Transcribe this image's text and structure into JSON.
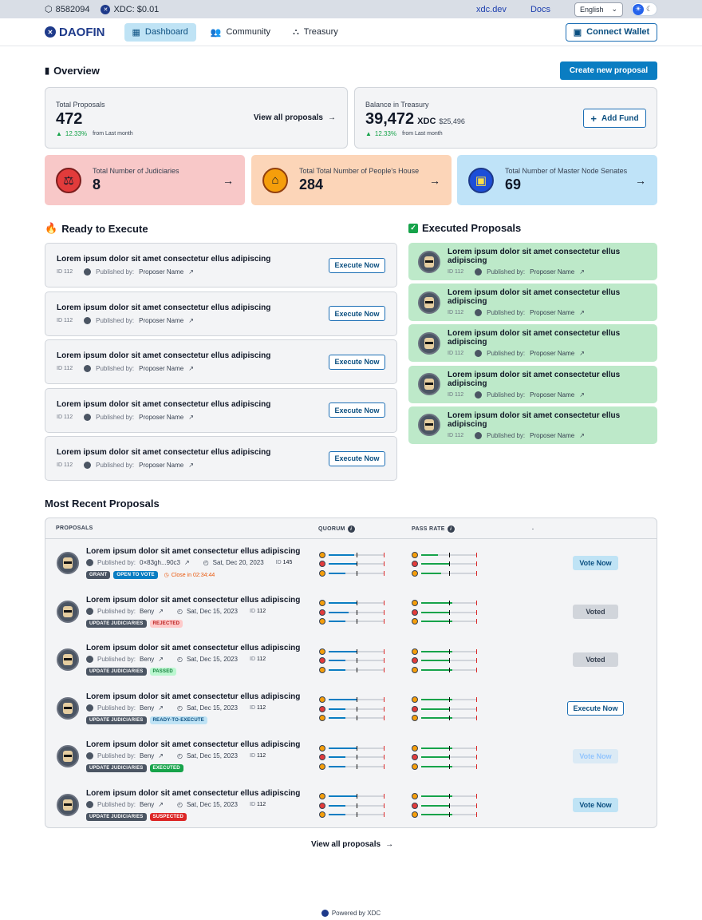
{
  "topbar": {
    "block": "8582094",
    "price": "XDC: $0.01",
    "link1": "xdc.dev",
    "link2": "Docs",
    "language": "English"
  },
  "nav": {
    "brand": "DAOFIN",
    "items": [
      "Dashboard",
      "Community",
      "Treasury"
    ],
    "connect": "Connect Wallet"
  },
  "overview": {
    "title": "Overview",
    "create_button": "Create new proposal",
    "total_proposals": {
      "label": "Total Proposals",
      "value": "472",
      "change": "12.33%",
      "change_note": "from Last month",
      "link": "View all proposals"
    },
    "treasury": {
      "label": "Balance in Treasury",
      "value": "39,472",
      "unit": "XDC",
      "usd": "$25,496",
      "change": "12.33%",
      "change_note": "from Last month",
      "button": "Add Fund"
    }
  },
  "tiles": [
    {
      "label": "Total Number of Judiciaries",
      "value": "8",
      "color": "#f8c8c8"
    },
    {
      "label": "Total Total Number of People's House",
      "value": "284",
      "color": "#fcd5b8"
    },
    {
      "label": "Total Number of Master Node Senates",
      "value": "69",
      "color": "#bfe3f8"
    }
  ],
  "ready": {
    "title": "Ready to Execute",
    "items": [
      {
        "title": "Lorem ipsum dolor sit amet consectetur ellus adipiscing",
        "id_label": "ID",
        "id": "112",
        "published": "Published by:",
        "proposer": "Proposer Name",
        "button": "Execute Now"
      },
      {
        "title": "Lorem ipsum dolor sit amet consectetur ellus adipiscing",
        "id_label": "ID",
        "id": "112",
        "published": "Published by:",
        "proposer": "Proposer Name",
        "button": "Execute Now"
      },
      {
        "title": "Lorem ipsum dolor sit amet consectetur ellus adipiscing",
        "id_label": "ID",
        "id": "112",
        "published": "Published by:",
        "proposer": "Proposer Name",
        "button": "Execute Now"
      },
      {
        "title": "Lorem ipsum dolor sit amet consectetur ellus adipiscing",
        "id_label": "ID",
        "id": "112",
        "published": "Published by:",
        "proposer": "Proposer Name",
        "button": "Execute Now"
      },
      {
        "title": "Lorem ipsum dolor sit amet consectetur ellus adipiscing",
        "id_label": "ID",
        "id": "112",
        "published": "Published by:",
        "proposer": "Proposer Name",
        "button": "Execute Now"
      }
    ]
  },
  "executed": {
    "title": "Executed Proposals",
    "items": [
      {
        "title": "Lorem ipsum dolor sit amet consectetur ellus adipiscing",
        "id_label": "ID",
        "id": "112",
        "published": "Published by:",
        "proposer": "Proposer Name"
      },
      {
        "title": "Lorem ipsum dolor sit amet consectetur ellus adipiscing",
        "id_label": "ID",
        "id": "112",
        "published": "Published by:",
        "proposer": "Proposer Name"
      },
      {
        "title": "Lorem ipsum dolor sit amet consectetur ellus adipiscing",
        "id_label": "ID",
        "id": "112",
        "published": "Published by:",
        "proposer": "Proposer Name"
      },
      {
        "title": "Lorem ipsum dolor sit amet consectetur ellus adipiscing",
        "id_label": "ID",
        "id": "112",
        "published": "Published by:",
        "proposer": "Proposer Name"
      },
      {
        "title": "Lorem ipsum dolor sit amet consectetur ellus adipiscing",
        "id_label": "ID",
        "id": "112",
        "published": "Published by:",
        "proposer": "Proposer Name"
      }
    ]
  },
  "recent": {
    "title": "Most Recent Proposals",
    "columns": [
      "PROPOSALS",
      "QUORUM",
      "PASS RATE",
      "."
    ],
    "rows": [
      {
        "title": "Lorem ipsum dolor sit amet consectetur ellus adipiscing",
        "published": "Published by:",
        "proposer": "0×83gh...90c3",
        "date": "Sat, Dec 20, 2023",
        "id_label": "ID",
        "id": "145",
        "tags": [
          {
            "text": "GRANT",
            "style": "dark"
          },
          {
            "text": "OPEN TO VOTE",
            "style": "blue"
          }
        ],
        "close": "Close in 02:34:44",
        "action": "Vote Now",
        "action_style": "vote",
        "quorum": [
          0.45,
          0.52,
          0.3
        ],
        "pass": [
          0.3,
          0.5,
          0.35
        ]
      },
      {
        "title": "Lorem ipsum dolor sit amet consectetur ellus adipiscing",
        "published": "Published by:",
        "proposer": "Beny",
        "date": "Sat, Dec 15, 2023",
        "id_label": "ID",
        "id": "112",
        "tags": [
          {
            "text": "UPDATE JUDICIARIES",
            "style": "dark"
          },
          {
            "text": "REJECTED",
            "style": "red"
          }
        ],
        "close": "",
        "action": "Voted",
        "action_style": "voted",
        "quorum": [
          0.5,
          0.35,
          0.3
        ],
        "pass": [
          0.55,
          0.5,
          0.55
        ]
      },
      {
        "title": "Lorem ipsum dolor sit amet consectetur ellus adipiscing",
        "published": "Published by:",
        "proposer": "Beny",
        "date": "Sat, Dec 15, 2023",
        "id_label": "ID",
        "id": "112",
        "tags": [
          {
            "text": "UPDATE JUDICIARIES",
            "style": "dark"
          },
          {
            "text": "PASSED",
            "style": "green"
          }
        ],
        "close": "",
        "action": "Voted",
        "action_style": "voted",
        "quorum": [
          0.5,
          0.3,
          0.3
        ],
        "pass": [
          0.55,
          0.5,
          0.55
        ]
      },
      {
        "title": "Lorem ipsum dolor sit amet consectetur ellus adipiscing",
        "published": "Published by:",
        "proposer": "Beny",
        "date": "Sat, Dec 15, 2023",
        "id_label": "ID",
        "id": "112",
        "tags": [
          {
            "text": "UPDATE JUDICIARIES",
            "style": "dark"
          },
          {
            "text": "READY-TO-EXECUTE",
            "style": "lblue"
          }
        ],
        "close": "",
        "action": "Execute Now",
        "action_style": "exec",
        "quorum": [
          0.5,
          0.3,
          0.3
        ],
        "pass": [
          0.55,
          0.5,
          0.55
        ]
      },
      {
        "title": "Lorem ipsum dolor sit amet consectetur ellus adipiscing",
        "published": "Published by:",
        "proposer": "Beny",
        "date": "Sat, Dec 15, 2023",
        "id_label": "ID",
        "id": "112",
        "tags": [
          {
            "text": "UPDATE JUDICIARIES",
            "style": "dark"
          },
          {
            "text": "EXECUTED",
            "style": "dgreen"
          }
        ],
        "close": "",
        "action": "Vote Now",
        "action_style": "vote-dis",
        "quorum": [
          0.5,
          0.3,
          0.3
        ],
        "pass": [
          0.55,
          0.5,
          0.55
        ]
      },
      {
        "title": "Lorem ipsum dolor sit amet consectetur ellus adipiscing",
        "published": "Published by:",
        "proposer": "Beny",
        "date": "Sat, Dec 15, 2023",
        "id_label": "ID",
        "id": "112",
        "tags": [
          {
            "text": "UPDATE JUDICIARIES",
            "style": "dark"
          },
          {
            "text": "SUSPECTED",
            "style": "dred"
          }
        ],
        "close": "",
        "action": "Vote Now",
        "action_style": "vote",
        "quorum": [
          0.5,
          0.3,
          0.3
        ],
        "pass": [
          0.55,
          0.5,
          0.55
        ]
      }
    ],
    "view_all": "View all proposals"
  },
  "footer": {
    "text": "Powered by XDC"
  },
  "colors": {
    "primary": "#0a7dc2",
    "executed_bg": "#bde9c9",
    "quorum_fill": "#0a7dc2",
    "pass_fill": "#16a34a"
  }
}
